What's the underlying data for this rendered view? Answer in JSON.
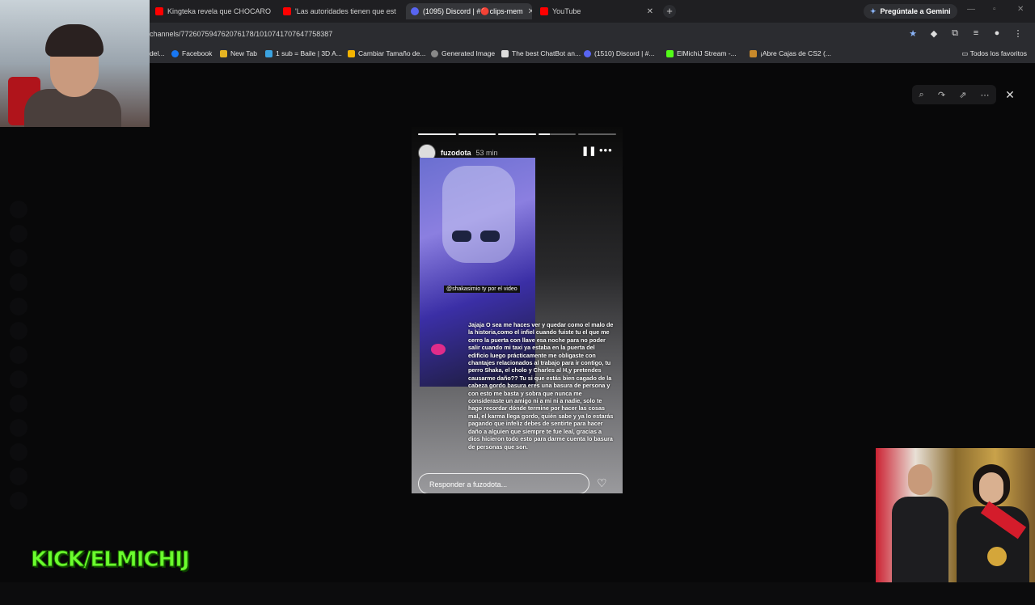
{
  "browser": {
    "tabs": [
      {
        "title": "Kingteka revela que CHOCARO",
        "icon": "youtube-icon",
        "active": false
      },
      {
        "title": "'Las autoridades tienen que est",
        "icon": "youtube-icon",
        "active": false
      },
      {
        "title": "(1095) Discord | #🔴clips-mem",
        "icon": "discord-icon",
        "active": true
      },
      {
        "title": "YouTube",
        "icon": "youtube-icon",
        "active": false
      }
    ],
    "gemini_label": "Pregúntale a Gemini",
    "url": "channels/772607594762076178/1010741707647758387",
    "bookmarks": [
      {
        "label": "del...",
        "icon": "bookmark-icon"
      },
      {
        "label": "Facebook",
        "icon": "facebook-icon"
      },
      {
        "label": "New Tab",
        "icon": "new-tab-icon"
      },
      {
        "label": "1 sub = Baile | 3D A...",
        "icon": "bookmark-icon"
      },
      {
        "label": "Cambiar Tamaño de...",
        "icon": "bookmark-icon"
      },
      {
        "label": "Generated Image",
        "icon": "bookmark-icon"
      },
      {
        "label": "The best ChatBot an...",
        "icon": "bookmark-icon"
      },
      {
        "label": "(1510) Discord | #...",
        "icon": "discord-icon"
      },
      {
        "label": "ElMichiJ Stream -...",
        "icon": "kick-icon"
      },
      {
        "label": "¡Abre Cajas de CS2 (...",
        "icon": "bookmark-icon"
      }
    ],
    "all_bookmarks": "Todos los favoritos"
  },
  "story": {
    "username": "fuzodota",
    "time": "53 min",
    "mention": "@shakasimio ty por el video",
    "caption": "Jajaja O sea me haces ver y quedar como el malo de la historia,como el infiel cuando fuiste tu el que me cerro la puerta con llave esa noche para no poder salir cuando mi taxi ya estaba en la puerta del edificio luego prácticamente me obligaste con chantajes relacionados al trabajo para ir contigo, tu perro Shaka, el cholo y Charles al H,y pretendes causarme daño?? Tu si que estás bien cagado de la cabeza gordo basura eres una basura de persona y con esto me basta y sobra que nunca me consideraste un amigo ni a mi ni a nadie, solo te hago recordar dónde termine por hacer las cosas mal, el karma llega gordo, quién sabe y ya lo estarás pagando que infeliz debes de sentirte para hacer daño a alguien que siempre te fue leal, gracias a dios hicieron todo esto para darme cuenta lo basura de personas que son.",
    "reply_placeholder": "Responder a fuzodota..."
  },
  "stream_overlay": {
    "kick_label": "KICK/ELMICHIJ"
  }
}
